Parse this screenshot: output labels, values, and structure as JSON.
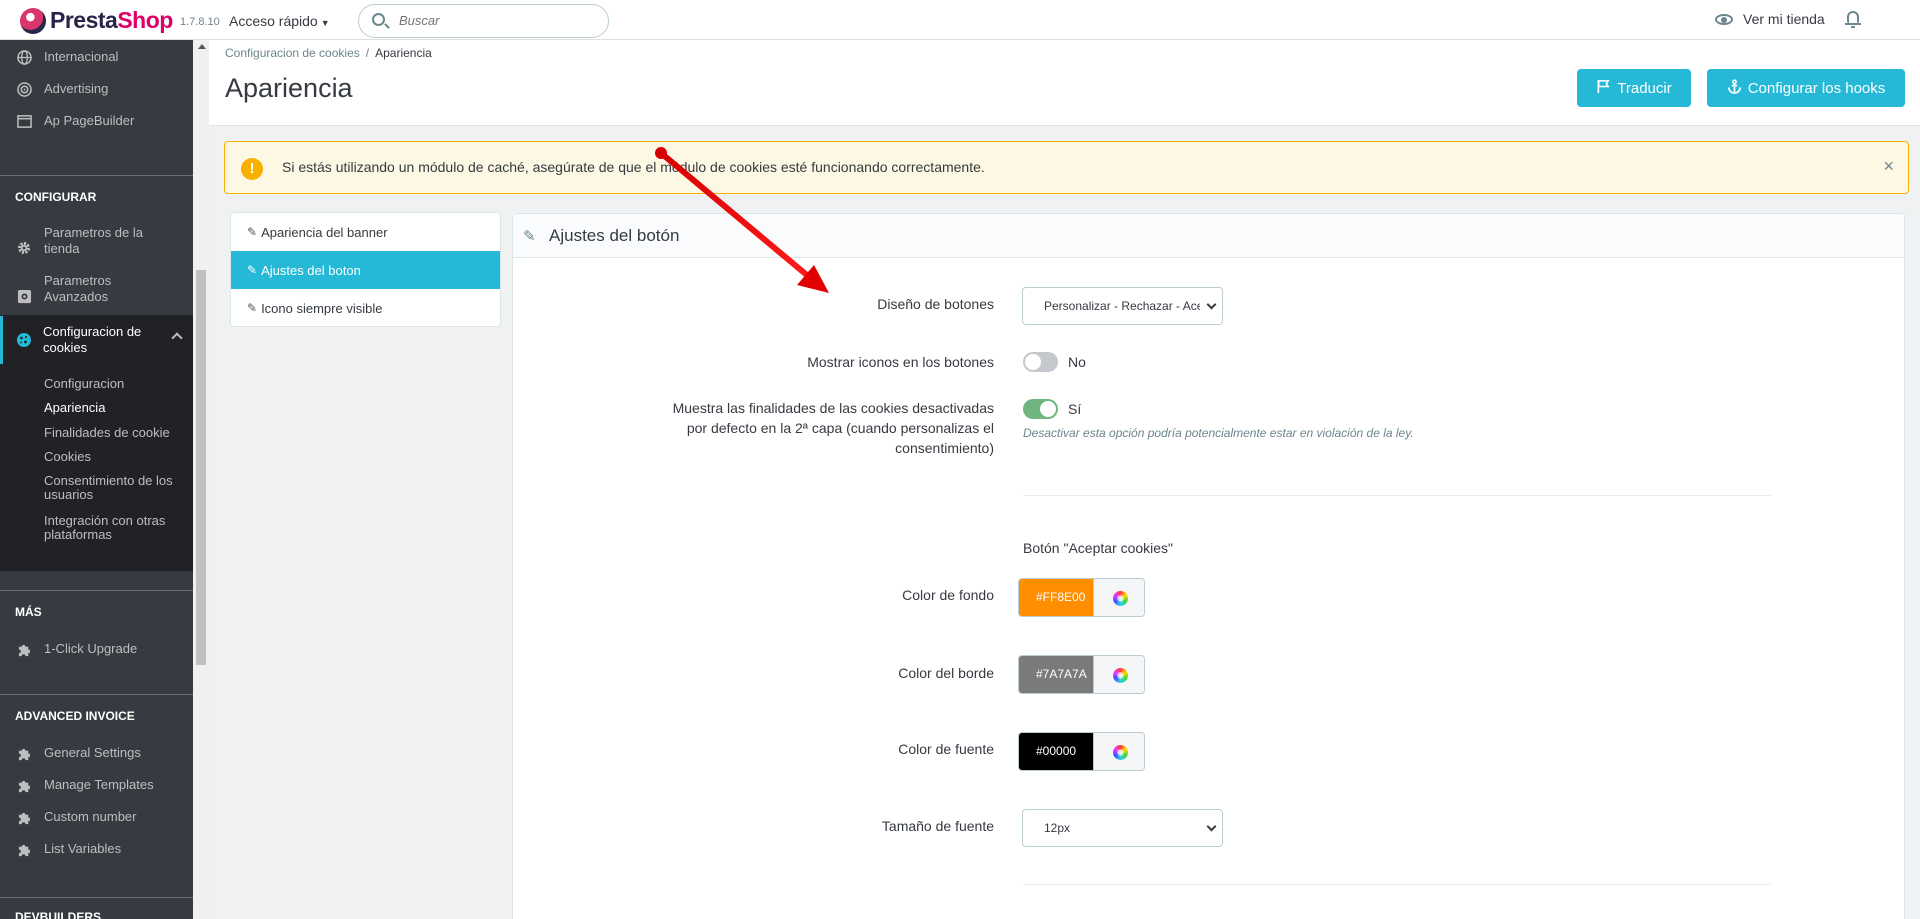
{
  "header": {
    "logo_text_a": "Presta",
    "logo_text_b": "Shop",
    "version": "1.7.8.10",
    "quick_access": "Acceso rápido",
    "search_placeholder": "Buscar",
    "view_store": "Ver mi tienda"
  },
  "sidebar": {
    "top_items": [
      {
        "label": "Internacional",
        "icon": "globe-icon"
      },
      {
        "label": "Advertising",
        "icon": "advertising-icon"
      },
      {
        "label": "Ap PageBuilder",
        "icon": "window-icon"
      }
    ],
    "configure_title": "CONFIGURAR",
    "configure_items": [
      {
        "label_1": "Parametros de la",
        "label_2": "tienda",
        "icon": "gear-icon"
      },
      {
        "label_1": "Parametros",
        "label_2": "Avanzados",
        "icon": "settings-icon"
      }
    ],
    "active_section": {
      "label_1": "Configuracion de",
      "label_2": "cookies",
      "icon": "cookie-icon"
    },
    "sub_items": [
      {
        "label": "Configuracion"
      },
      {
        "label": "Apariencia"
      },
      {
        "label": "Finalidades de cookie"
      },
      {
        "label": "Cookies"
      },
      {
        "label_1": "Consentimiento de los",
        "label_2": "usuarios"
      },
      {
        "label_1": "Integración con otras",
        "label_2": "plataformas"
      }
    ],
    "more_title": "MÁS",
    "more_items": [
      {
        "label": "1-Click Upgrade",
        "icon": "puzzle-icon"
      }
    ],
    "invoice_title": "ADVANCED INVOICE",
    "invoice_items": [
      {
        "label": "General Settings",
        "icon": "puzzle-icon"
      },
      {
        "label": "Manage Templates",
        "icon": "puzzle-icon"
      },
      {
        "label": "Custom number",
        "icon": "puzzle-icon"
      },
      {
        "label": "List Variables",
        "icon": "puzzle-icon"
      }
    ],
    "devbuilders_title": "DEVBUILDERS"
  },
  "page": {
    "breadcrumb_parent": "Configuracion de cookies",
    "breadcrumb_sep": "/",
    "breadcrumb_current": "Apariencia",
    "title": "Apariencia",
    "translate_button": "Traducir",
    "hooks_button": "Configurar los hooks"
  },
  "alert": {
    "text": "Si estás utilizando un módulo de caché, asegúrate de que el módulo de cookies esté funcionando correctamente.",
    "close": "×"
  },
  "subtabs": [
    {
      "label": "Apariencia del banner"
    },
    {
      "label": "Ajustes del boton"
    },
    {
      "label": "Icono siempre visible"
    }
  ],
  "panel": {
    "title": "Ajustes del botón",
    "fields": {
      "button_design_label": "Diseño de botones",
      "button_design_value": "Personalizar - Rechazar - Aceptar",
      "show_icons_label": "Mostrar iconos en los botones",
      "show_icons_value": "No",
      "show_purposes_label_1": "Muestra las finalidades de las cookies desactivadas",
      "show_purposes_label_2": "por defecto en la 2ª capa (cuando personalizas el",
      "show_purposes_label_3": "consentimiento)",
      "show_purposes_value": "Sí",
      "show_purposes_help": "Desactivar esta opción podría potencialmente estar en violación de la ley.",
      "accept_button_heading": "Botón \"Aceptar cookies\"",
      "bg_color_label": "Color de fondo",
      "bg_color_value": "#FF8E00",
      "border_color_label": "Color del borde",
      "border_color_value": "#7A7A7A",
      "font_color_label": "Color de fuente",
      "font_color_value": "#00000",
      "font_size_label": "Tamaño de fuente",
      "font_size_value": "12px"
    }
  },
  "colors": {
    "accent": "#25b9d7",
    "sidebar_bg": "#363a41",
    "warning": "#fab000",
    "toggle_on": "#70b580",
    "swatch_bg": "#ff8e00",
    "swatch_border": "#7a7a7a",
    "swatch_font": "#000000",
    "annotation_arrow": "#e00000"
  }
}
